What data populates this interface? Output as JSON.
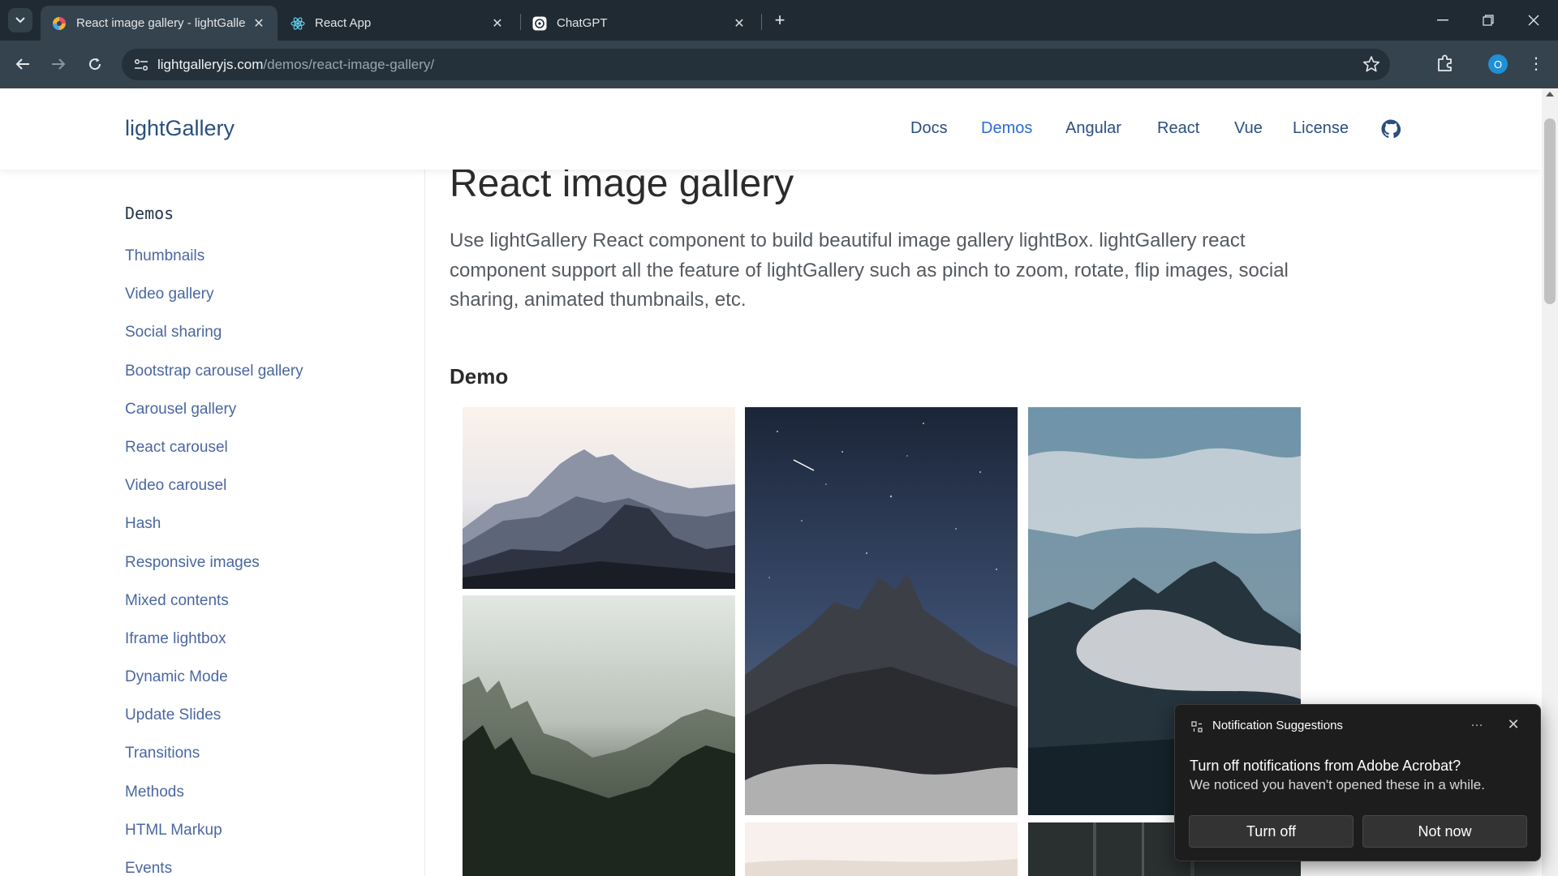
{
  "browser": {
    "tabs": [
      {
        "title": "React image gallery - lightGalle",
        "active": true
      },
      {
        "title": "React App",
        "active": false
      },
      {
        "title": "ChatGPT",
        "active": false
      }
    ],
    "url_host": "lightgalleryjs.com",
    "url_path": "/demos/react-image-gallery/",
    "profile_initial": "O"
  },
  "site": {
    "brand": "lightGallery",
    "nav": [
      "Docs",
      "Demos",
      "Angular",
      "React",
      "Vue",
      "License"
    ],
    "active_nav": "Demos"
  },
  "sidebar": {
    "heading": "Demos",
    "items": [
      "Thumbnails",
      "Video gallery",
      "Social sharing",
      "Bootstrap carousel gallery",
      "Carousel gallery",
      "React carousel",
      "Video carousel",
      "Hash",
      "Responsive images",
      "Mixed contents",
      "Iframe lightbox",
      "Dynamic Mode",
      "Update Slides",
      "Transitions",
      "Methods",
      "HTML Markup",
      "Events"
    ]
  },
  "main": {
    "title": "React image gallery",
    "lead": "Use lightGallery React component to build beautiful image gallery lightBox. lightGallery react component support all the feature of lightGallery such as pinch to zoom, rotate, flip images, social sharing, animated thumbnails, etc.",
    "demo_heading": "Demo"
  },
  "notification": {
    "app": "Notification Suggestions",
    "title": "Turn off notifications from Adobe Acrobat?",
    "body": "We noticed you haven't opened these in a while.",
    "primary_button": "Turn off",
    "secondary_button": "Not now"
  },
  "colors": {
    "chrome_dark": "#1f2a33",
    "chrome_toolbar": "#35434e",
    "link": "#4a67a0",
    "nav": "#2a4f7e",
    "nav_active": "#2a6ad4"
  }
}
